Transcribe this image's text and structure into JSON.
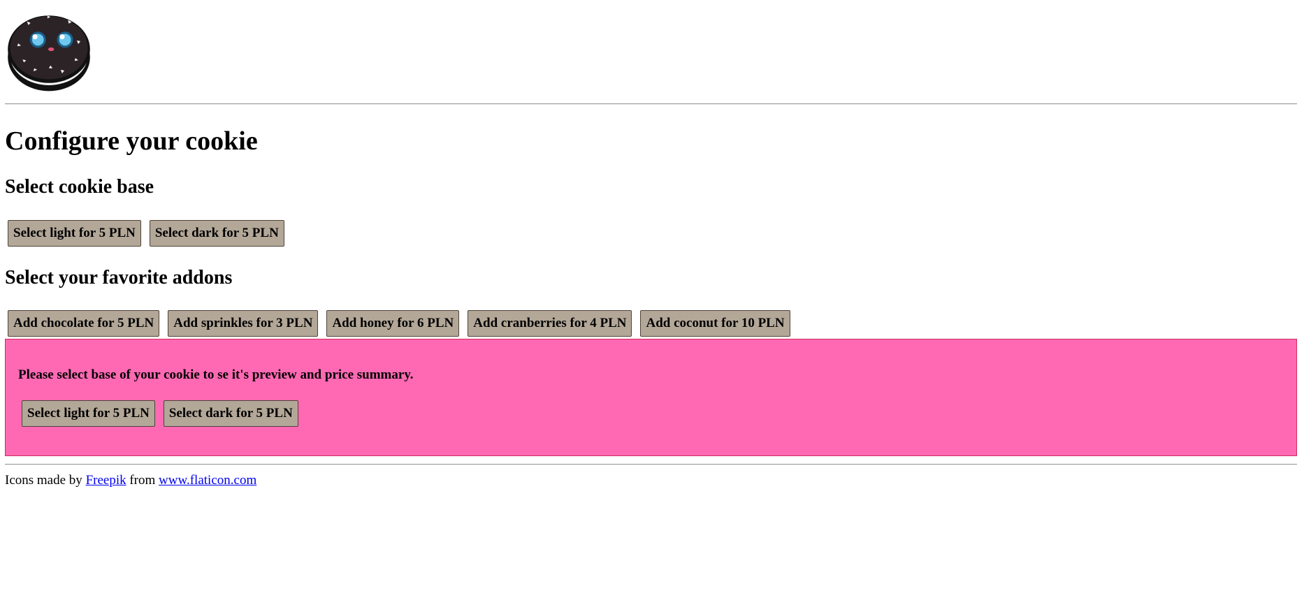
{
  "header": {
    "logo_icon": "cookie-mascot-icon"
  },
  "main": {
    "title": "Configure your cookie",
    "base_section": {
      "title": "Select cookie base",
      "buttons": [
        "Select light for 5 PLN",
        "Select dark for 5 PLN"
      ]
    },
    "addons_section": {
      "title": "Select your favorite addons",
      "buttons": [
        "Add chocolate for 5 PLN",
        "Add sprinkles for 3 PLN",
        "Add honey for 6 PLN",
        "Add cranberries for 4 PLN",
        "Add coconut for 10 PLN"
      ]
    },
    "summary": {
      "message": "Please select base of your cookie to se it's preview and price summary.",
      "buttons": [
        "Select light for 5 PLN",
        "Select dark for 5 PLN"
      ],
      "background_color": "#ff69b4",
      "border_color": "#d12a5b"
    }
  },
  "footer": {
    "prefix": "Icons made by ",
    "author_link": "Freepik",
    "middle": " from ",
    "site_link": "www.flaticon.com"
  },
  "colors": {
    "button_bg": "#b3a798",
    "link": "#0000ee"
  }
}
